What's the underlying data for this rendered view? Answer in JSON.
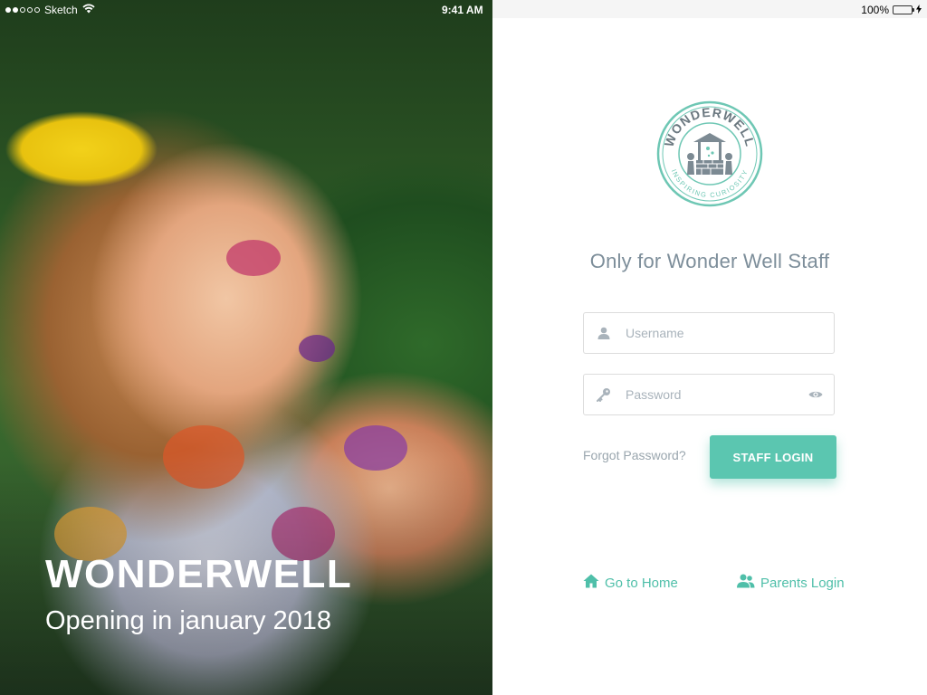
{
  "status_bar": {
    "carrier": "Sketch",
    "time": "9:41 AM",
    "battery": "100%"
  },
  "hero": {
    "title": "WONDERWELL",
    "subtitle": "Opening in january 2018"
  },
  "logo": {
    "brand_text": "WONDERWELL",
    "tagline": "INSPIRING CURIOSITY",
    "accent_color": "#5bc6b0"
  },
  "login": {
    "heading": "Only for Wonder Well  Staff",
    "username_placeholder": "Username",
    "password_placeholder": "Password",
    "forgot_label": "Forgot Password?",
    "submit_label": "STAFF LOGIN"
  },
  "footer": {
    "home_label": "Go to Home",
    "parents_label": "Parents Login"
  },
  "colors": {
    "accent": "#5bc6b0",
    "heading_text": "#7d8e9a",
    "muted_text": "#9aa6ae"
  }
}
